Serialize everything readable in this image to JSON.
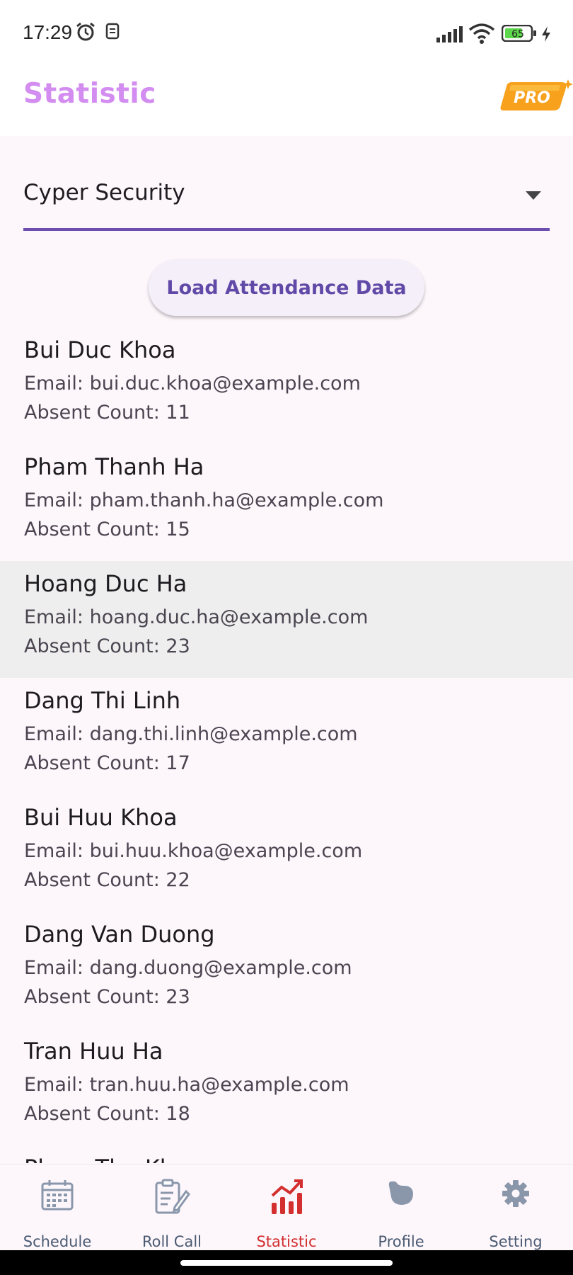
{
  "status_bar": {
    "time": "17:29",
    "battery": "65"
  },
  "app_bar": {
    "title": "Statistic",
    "pro_label": "PRO"
  },
  "course_select": {
    "selected": "Cyper Security"
  },
  "load_button": {
    "label": "Load Attendance Data"
  },
  "students": [
    {
      "name": "Bui Duc Khoa",
      "email": "Email: bui.duc.khoa@example.com",
      "absent": "Absent Count: 11"
    },
    {
      "name": "Pham Thanh Ha",
      "email": "Email: pham.thanh.ha@example.com",
      "absent": "Absent Count: 15"
    },
    {
      "name": "Hoang Duc Ha",
      "email": "Email: hoang.duc.ha@example.com",
      "absent": "Absent Count: 23"
    },
    {
      "name": "Dang Thi Linh",
      "email": "Email: dang.thi.linh@example.com",
      "absent": "Absent Count: 17"
    },
    {
      "name": "Bui Huu Khoa",
      "email": "Email: bui.huu.khoa@example.com",
      "absent": "Absent Count: 22"
    },
    {
      "name": "Dang Van Duong",
      "email": "Email: dang.duong@example.com",
      "absent": "Absent Count: 23"
    },
    {
      "name": "Tran Huu Ha",
      "email": "Email: tran.huu.ha@example.com",
      "absent": "Absent Count: 18"
    },
    {
      "name": "Pham Thu Khoa",
      "email": "",
      "absent": ""
    }
  ],
  "nav": [
    {
      "label": "Schedule",
      "icon": "calendar-icon"
    },
    {
      "label": "Roll Call",
      "icon": "roll-call-icon"
    },
    {
      "label": "Statistic",
      "icon": "statistic-icon",
      "active": true
    },
    {
      "label": "Profile",
      "icon": "profile-icon"
    },
    {
      "label": "Setting",
      "icon": "gear-icon"
    }
  ],
  "colors": {
    "title": "#d38cf0",
    "accent": "#6b4eb0",
    "active_nav": "#d32f2f",
    "pro_badge": "#f7a11d"
  }
}
